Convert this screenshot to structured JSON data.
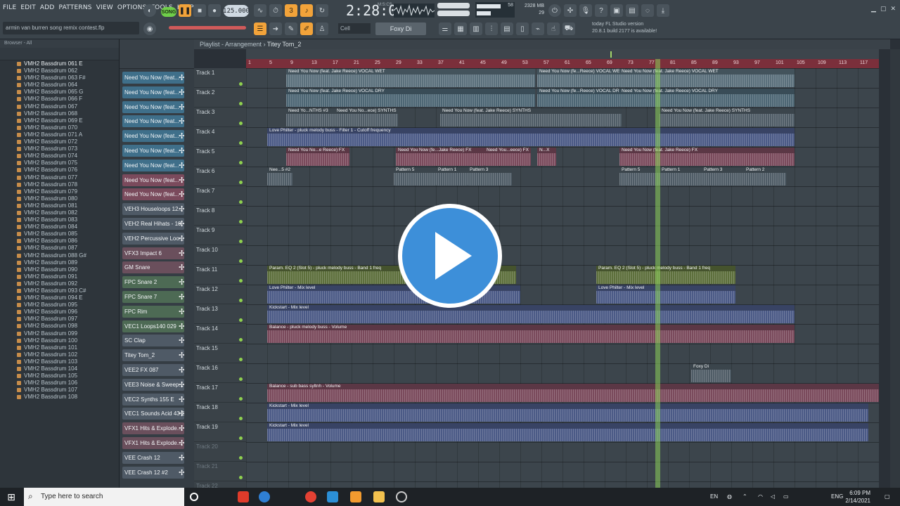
{
  "menu": [
    "FILE",
    "EDIT",
    "ADD",
    "PATTERNS",
    "VIEW",
    "OPTIONS",
    "TOOLS",
    "HELP"
  ],
  "hint": "armin van burren song remix contest.flp",
  "transport": {
    "song_mode": "SONG",
    "tempo": "125.000",
    "time": "2:28:03",
    "time_sub": "M:S:CS"
  },
  "cpu": {
    "memory": "2328 MB",
    "voices": "29",
    "cpu_value": "58"
  },
  "pattern_selector": "Foxy Di",
  "snap": "Cell",
  "news": {
    "line1": "today  FL Studio version",
    "line2": "20.8.1 build 2177 is available!"
  },
  "browser": {
    "header": "Browser - All",
    "items": [
      "VMH2 Bassdrum 061 E",
      "VMH2 Bassdrum 062",
      "VMH2 Bassdrum 063 F#",
      "VMH2 Bassdrum 064",
      "VMH2 Bassdrum 065 G",
      "VMH2 Bassdrum 066 F",
      "VMH2 Bassdrum 067",
      "VMH2 Bassdrum 068",
      "VMH2 Bassdrum 069 E",
      "VMH2 Bassdrum 070",
      "VMH2 Bassdrum 071 A",
      "VMH2 Bassdrum 072",
      "VMH2 Bassdrum 073",
      "VMH2 Bassdrum 074",
      "VMH2 Bassdrum 075",
      "VMH2 Bassdrum 076",
      "VMH2 Bassdrum 077",
      "VMH2 Bassdrum 078",
      "VMH2 Bassdrum 079",
      "VMH2 Bassdrum 080",
      "VMH2 Bassdrum 081",
      "VMH2 Bassdrum 082",
      "VMH2 Bassdrum 083",
      "VMH2 Bassdrum 084",
      "VMH2 Bassdrum 085",
      "VMH2 Bassdrum 086",
      "VMH2 Bassdrum 087",
      "VMH2 Bassdrum 088 G#",
      "VMH2 Bassdrum 089",
      "VMH2 Bassdrum 090",
      "VMH2 Bassdrum 091",
      "VMH2 Bassdrum 092",
      "VMH2 Bassdrum 093 C#",
      "VMH2 Bassdrum 094 E",
      "VMH2 Bassdrum 095",
      "VMH2 Bassdrum 096",
      "VMH2 Bassdrum 097",
      "VMH2 Bassdrum 098",
      "VMH2 Bassdrum 099",
      "VMH2 Bassdrum 100",
      "VMH2 Bassdrum 101",
      "VMH2 Bassdrum 102",
      "VMH2 Bassdrum 103",
      "VMH2 Bassdrum 104",
      "VMH2 Bassdrum 105",
      "VMH2 Bassdrum 106",
      "VMH2 Bassdrum 107",
      "VMH2 Bassdrum 108"
    ]
  },
  "channels": [
    {
      "name": "Need You Now (feat...",
      "color": "#3f6f8a"
    },
    {
      "name": "Need You Now (feat...",
      "color": "#3f6f8a"
    },
    {
      "name": "Need You Now (feat...",
      "color": "#3f6f8a"
    },
    {
      "name": "Need You Now (feat...",
      "color": "#3f6f8a"
    },
    {
      "name": "Need You Now (feat...",
      "color": "#3f6f8a"
    },
    {
      "name": "Need You Now (feat...",
      "color": "#3f6f8a"
    },
    {
      "name": "Need You Now (feat...",
      "color": "#3f6f8a"
    },
    {
      "name": "Need You Now (feat...",
      "color": "#7a4a5c"
    },
    {
      "name": "Need You Now (feat...",
      "color": "#7a4a5c"
    },
    {
      "name": "VEH3 Houseloops 12...",
      "color": "#4f5a66"
    },
    {
      "name": "VEH2 Real Hihats - 10",
      "color": "#4f5a66"
    },
    {
      "name": "VEH2 Percussive Loo...",
      "color": "#4f5a66"
    },
    {
      "name": "VFX3 Impact 6",
      "color": "#6a4f5c"
    },
    {
      "name": "GM Snare",
      "color": "#6a4f5c"
    },
    {
      "name": "FPC Snare 2",
      "color": "#4d6a54"
    },
    {
      "name": "FPC Snare 7",
      "color": "#4d6a54"
    },
    {
      "name": "FPC Rim",
      "color": "#4d6a54"
    },
    {
      "name": "VEC1 Loops140 029",
      "color": "#4d6a54"
    },
    {
      "name": "SC Clap",
      "color": "#4f5a66"
    },
    {
      "name": "Titey Tom_2",
      "color": "#4f5a66"
    },
    {
      "name": "VEE2 FX 087",
      "color": "#4f5a66"
    },
    {
      "name": "VEE3 Noise & Sweep...",
      "color": "#4f5a66"
    },
    {
      "name": "VEC2 Synths 155 E",
      "color": "#4f5a66"
    },
    {
      "name": "VEC1 Sounds Acid 43 C",
      "color": "#4f5a66"
    },
    {
      "name": "VFX1 Hits & Explode...",
      "color": "#6a4f5c"
    },
    {
      "name": "VFX1 Hits & Explode...",
      "color": "#6a4f5c"
    },
    {
      "name": "VEE Crash 12",
      "color": "#4f5a66"
    },
    {
      "name": "VEE Crash 12 #2",
      "color": "#4f5a66"
    }
  ],
  "playlist": {
    "title": "Playlist - Arrangement",
    "pattern": "Titey Tom_2",
    "ruler": [
      "1",
      "5",
      "9",
      "13",
      "17",
      "21",
      "25",
      "29",
      "33",
      "37",
      "41",
      "45",
      "49",
      "53",
      "57",
      "61",
      "65",
      "69",
      "73",
      "77",
      "81",
      "85",
      "89",
      "93",
      "97",
      "101",
      "105",
      "109",
      "113",
      "117"
    ],
    "tracks": [
      "Track 1",
      "Track 2",
      "Track 3",
      "Track 4",
      "Track 5",
      "Track 6",
      "Track 7",
      "Track 8",
      "Track 9",
      "Track 10",
      "Track 11",
      "Track 12",
      "Track 13",
      "Track 14",
      "Track 15",
      "Track 16",
      "Track 17",
      "Track 18",
      "Track 19",
      "Track 20",
      "Track 21",
      "Track 22"
    ],
    "clips": [
      {
        "track": 0,
        "start": 1.9,
        "len": 11.8,
        "label": "Need You Now (feat. Jake Reece) VOCAL WET",
        "color": "#5a6f7b"
      },
      {
        "track": 0,
        "start": 13.8,
        "len": 3.9,
        "label": "Need You Now (fe...Reece) VOCAL WET",
        "color": "#5a6f7b"
      },
      {
        "track": 0,
        "start": 17.7,
        "len": 8.3,
        "label": "Need You Now (feat. Jake Reece) VOCAL WET",
        "color": "#5a6f7b"
      },
      {
        "track": 1,
        "start": 1.9,
        "len": 11.8,
        "label": "Need You Now (feat. Jake Reece) VOCAL DRY",
        "color": "#4d6674"
      },
      {
        "track": 1,
        "start": 13.8,
        "len": 3.9,
        "label": "Need You Now (fe...Reece) VOCAL DRY",
        "color": "#4d6674"
      },
      {
        "track": 1,
        "start": 17.7,
        "len": 8.3,
        "label": "Need You Now (feat. Jake Reece) VOCAL DRY",
        "color": "#4d6674"
      },
      {
        "track": 2,
        "start": 1.9,
        "len": 2.3,
        "label": "Need Yo...NTHS #3",
        "color": "#4f5c66"
      },
      {
        "track": 2,
        "start": 4.2,
        "len": 3.0,
        "label": "Need You No...ece) SYNTHS",
        "color": "#4f5c66"
      },
      {
        "track": 2,
        "start": 9.2,
        "len": 8.6,
        "label": "Need You Now (feat. Jake Reece) SYNTHS",
        "color": "#4f5c66"
      },
      {
        "track": 2,
        "start": 19.6,
        "len": 6.4,
        "label": "Need You Now (feat. Jake Reece) SYNTHS",
        "color": "#4f5c66"
      },
      {
        "track": 3,
        "start": 1.0,
        "len": 25.0,
        "label": "Love Philter - pluck melody buss - Filter 1 - Cutoff frequency",
        "color": "#4b5a86"
      },
      {
        "track": 4,
        "start": 1.9,
        "len": 3.0,
        "label": "Need You No...e Reece) FX",
        "color": "#7a4a5c"
      },
      {
        "track": 4,
        "start": 7.1,
        "len": 4.2,
        "label": "Need You Now (fe...Jake Reece) FX",
        "color": "#7a4a5c"
      },
      {
        "track": 4,
        "start": 11.3,
        "len": 2.2,
        "label": "Need You...eece) FX",
        "color": "#7a4a5c"
      },
      {
        "track": 4,
        "start": 13.8,
        "len": 0.9,
        "label": "N...X",
        "color": "#7a4a5c"
      },
      {
        "track": 4,
        "start": 17.7,
        "len": 8.3,
        "label": "Need You Now (feat. Jake Reece) FX",
        "color": "#7a4a5c"
      },
      {
        "track": 5,
        "start": 1.0,
        "len": 1.2,
        "label": "Nee...5 #2",
        "color": "#4f5c66"
      },
      {
        "track": 5,
        "start": 7.0,
        "len": 2.0,
        "label": "Pattern 5",
        "color": "#4f5c66"
      },
      {
        "track": 5,
        "start": 9.0,
        "len": 1.5,
        "label": "Pattern 1",
        "color": "#4f5c66"
      },
      {
        "track": 5,
        "start": 10.5,
        "len": 2.1,
        "label": "Pattern 3",
        "color": "#4f5c66"
      },
      {
        "track": 5,
        "start": 17.7,
        "len": 1.9,
        "label": "Pattern 5",
        "color": "#4f5c66"
      },
      {
        "track": 5,
        "start": 19.6,
        "len": 2.0,
        "label": "Pattern 1",
        "color": "#4f5c66"
      },
      {
        "track": 5,
        "start": 21.6,
        "len": 2.0,
        "label": "Pattern 3",
        "color": "#4f5c66"
      },
      {
        "track": 5,
        "start": 23.6,
        "len": 2.0,
        "label": "Pattern 2",
        "color": "#4f5c66"
      },
      {
        "track": 10,
        "start": 1.0,
        "len": 11.8,
        "label": "Param. EQ 2 (Slot 5) - pluck melody buss - Band 1 freq",
        "color": "#5d6f3c"
      },
      {
        "track": 10,
        "start": 16.6,
        "len": 6.6,
        "label": "Param. EQ 2 (Slot 5) - pluck melody buss - Band 1 freq",
        "color": "#5d6f3c"
      },
      {
        "track": 11,
        "start": 1.0,
        "len": 12.0,
        "label": "Love Philter - Mix level",
        "color": "#4b5a86"
      },
      {
        "track": 11,
        "start": 16.6,
        "len": 6.6,
        "label": "Love Philter - Mix level",
        "color": "#4b5a86"
      },
      {
        "track": 12,
        "start": 1.0,
        "len": 25.0,
        "label": "Kickstart - Mix level",
        "color": "#4b5a86"
      },
      {
        "track": 13,
        "start": 1.0,
        "len": 25.0,
        "label": "Balance - pluck melody buss - Volume",
        "color": "#7a4a5c"
      },
      {
        "track": 15,
        "start": 21.1,
        "len": 1.9,
        "label": "Foxy Di",
        "color": "#4f5c66"
      },
      {
        "track": 16,
        "start": 1.0,
        "len": 29.0,
        "label": "Balance - sub bass syltnh - Volume",
        "color": "#7a4a5c"
      },
      {
        "track": 17,
        "start": 1.0,
        "len": 28.5,
        "label": "Kickstart - Mix level",
        "color": "#4b5a86"
      },
      {
        "track": 18,
        "start": 1.0,
        "len": 28.5,
        "label": "Kickstart - Mix level",
        "color": "#4b5a86"
      }
    ]
  },
  "taskbar": {
    "search_placeholder": "Type here to search",
    "lang": "EN",
    "keyboard": "ENG",
    "time": "6:09 PM",
    "date": "2/14/2021"
  }
}
